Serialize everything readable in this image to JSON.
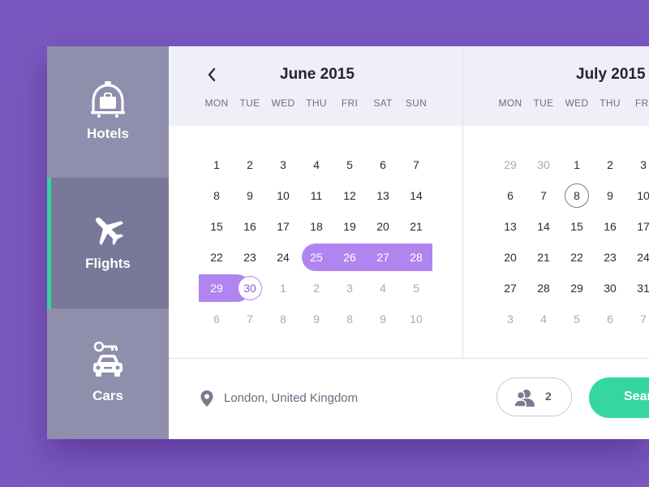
{
  "sidebar": {
    "items": [
      {
        "label": "Hotels",
        "icon": "hotel-bell-luggage-icon"
      },
      {
        "label": "Flights",
        "icon": "airplane-icon",
        "active": true
      },
      {
        "label": "Cars",
        "icon": "car-key-icon"
      }
    ]
  },
  "calendar": {
    "weekdays": [
      "MON",
      "TUE",
      "WED",
      "THU",
      "FRI",
      "SAT",
      "SUN"
    ],
    "prev_icon": "chevron-left-icon",
    "months": [
      {
        "title": "June 2015",
        "weeks": [
          [
            "1",
            "2",
            "3",
            "4",
            "5",
            "6",
            "7"
          ],
          [
            "8",
            "9",
            "10",
            "11",
            "12",
            "13",
            "14"
          ],
          [
            "15",
            "16",
            "17",
            "18",
            "19",
            "20",
            "21"
          ],
          [
            "22",
            "23",
            "24",
            "25",
            "26",
            "27",
            "28"
          ],
          [
            "29",
            "30",
            "1",
            "2",
            "3",
            "4",
            "5"
          ],
          [
            "6",
            "7",
            "8",
            "9",
            "8",
            "9",
            "10"
          ]
        ],
        "range": [
          "25",
          "26",
          "27",
          "28",
          "29"
        ],
        "range_end": "30"
      },
      {
        "title": "July 2015",
        "weeks": [
          [
            "29",
            "30",
            "1",
            "2",
            "3"
          ],
          [
            "6",
            "7",
            "8",
            "9",
            "10"
          ],
          [
            "13",
            "14",
            "15",
            "16",
            "17"
          ],
          [
            "20",
            "21",
            "22",
            "23",
            "24"
          ],
          [
            "27",
            "28",
            "29",
            "30",
            "31"
          ],
          [
            "3",
            "4",
            "5",
            "6",
            "7"
          ]
        ],
        "today": "8"
      }
    ]
  },
  "search": {
    "location": "London, United Kingdom",
    "location_icon": "map-pin-icon",
    "guests": "2",
    "guests_icon": "users-icon",
    "button_label": "Search"
  },
  "colors": {
    "background": "#7b58bf",
    "sidebar": "#8f8ead",
    "sidebar_active": "#7a7898",
    "accent_green": "#35d79e",
    "range_purple": "#b185f0"
  }
}
